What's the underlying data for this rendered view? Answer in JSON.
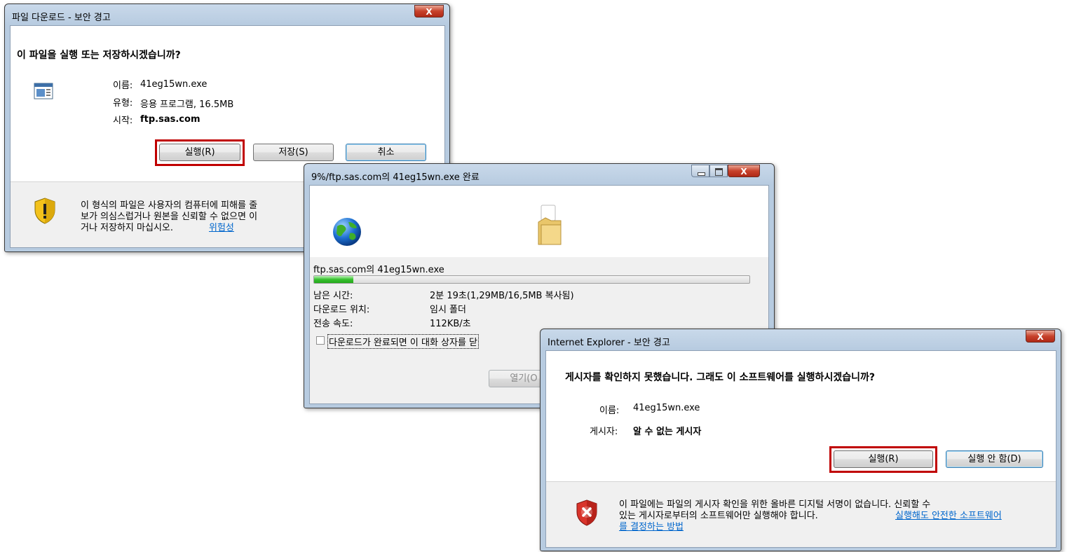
{
  "dlg1": {
    "title": "파일 다운로드 - 보안 경고",
    "heading": "이 파일을 실행 또는 저장하시겠습니까?",
    "name_label": "이름:",
    "name_value": "41eg15wn.exe",
    "type_label": "유형:",
    "type_value": "응용 프로그램, 16.5MB",
    "from_label": "시작:",
    "from_value": "ftp.sas.com",
    "run_button": "실행(R)",
    "save_button": "저장(S)",
    "cancel_button": "취소",
    "warning_line1": "이 형식의 파일은 사용자의 컴퓨터에 피해를 줄",
    "warning_line2": "보가 의심스럽거나 원본을 신뢰할 수 없으면 이",
    "warning_line3": "거나 저장하지 마십시오.",
    "warning_link": "위험성"
  },
  "dlg2": {
    "title": "9%/ftp.sas.com의 41eg15wn.exe  완료",
    "source": "ftp.sas.com의 41eg15wn.exe",
    "progress_percent": 9,
    "time_left_label": "남은 시간:",
    "time_left_value": "2분 19초(1,29MB/16,5MB 복사됨)",
    "location_label": "다운로드 위치:",
    "location_value": "임시 폴더",
    "speed_label": "전송 속도:",
    "speed_value": "112KB/초",
    "close_checkbox": "다운로드가 완료되면 이 대화 상자를 닫",
    "open_button": "열기(O"
  },
  "dlg3": {
    "title": "Internet Explorer - 보안 경고",
    "heading": "게시자를 확인하지 못했습니다. 그래도 이 소프트웨어를 실행하시겠습니까?",
    "name_label": "이름:",
    "name_value": "41eg15wn.exe",
    "publisher_label": "게시자:",
    "publisher_value": "알 수 없는 게시자",
    "run_button": "실행(R)",
    "dont_run_button": "실행 안 함(D)",
    "warning_line1": "이 파일에는 파일의 게시자 확인을 위한 올바른 디지털 서명이 없습니다. 신뢰할 수",
    "warning_line2_text": "있는 게시자로부터의 소프트웨어만 실행해야 합니다.",
    "warning_link_part1": "실행해도 안전한 소프트웨어",
    "warning_link_part2": "를 결정하는 방법"
  },
  "icons": {
    "close": "X"
  }
}
